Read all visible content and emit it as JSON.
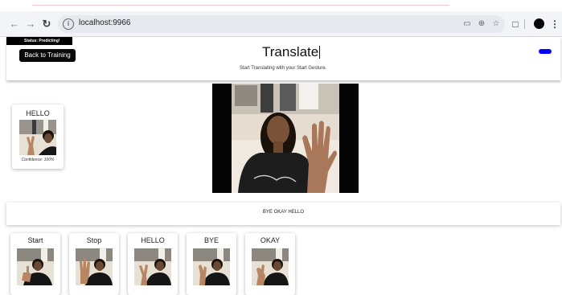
{
  "browser": {
    "url": "localhost:9966"
  },
  "header": {
    "status": "Status: Predicting!",
    "back_button": "Back to Training",
    "title": "Translate",
    "subtitle": "Start Translating with your Start Gesture."
  },
  "detected": {
    "label": "HELLO",
    "confidence": "Confidence: 100%"
  },
  "sentence": "BYE OKAY HELLO",
  "gestures": [
    {
      "label": "Start"
    },
    {
      "label": "Stop"
    },
    {
      "label": "HELLO"
    },
    {
      "label": "BYE"
    },
    {
      "label": "OKAY"
    }
  ]
}
